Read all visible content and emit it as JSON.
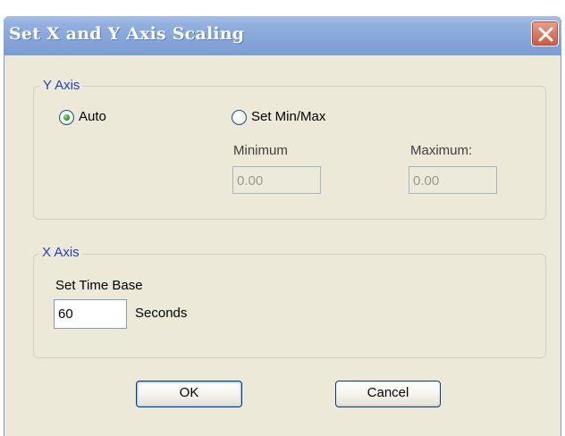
{
  "window": {
    "title": "Set X and Y Axis Scaling"
  },
  "y_axis": {
    "group_label": "Y Axis",
    "auto_label": "Auto",
    "auto_selected": true,
    "set_minmax_label": "Set Min/Max",
    "set_minmax_selected": false,
    "minimum_label": "Minimum",
    "maximum_label": "Maximum:",
    "minimum_value": "0.00",
    "maximum_value": "0.00"
  },
  "x_axis": {
    "group_label": "X Axis",
    "time_base_label": "Set Time Base",
    "time_base_value": "60",
    "seconds_label": "Seconds"
  },
  "buttons": {
    "ok_label": "OK",
    "cancel_label": "Cancel"
  },
  "icons": {
    "close": "close-icon"
  },
  "colors": {
    "title_bar": "#86a6d9",
    "close_button": "#d97e68",
    "dialog_background": "#ece9d8",
    "group_label": "#1f3fc8",
    "radio_selected_dot": "#2d9a2d"
  }
}
